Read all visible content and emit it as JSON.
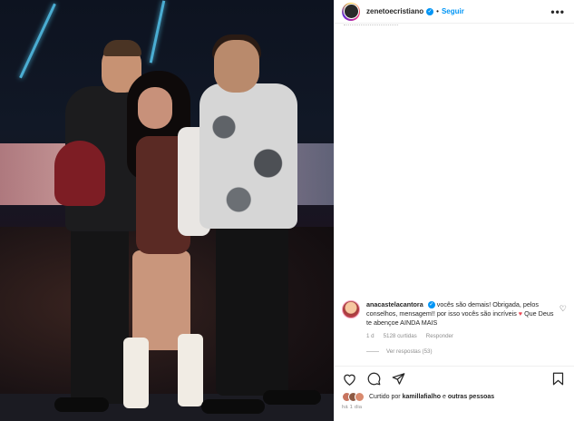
{
  "post": {
    "username": "zenetoecristiano",
    "follow_label": "Seguir",
    "more_label": "•••",
    "separator": "•"
  },
  "comment": {
    "username": "anacastelacantora",
    "text": "vocês são demais! Obrigada, pelos conselhos, mensagem!! por isso vocês são incríveis",
    "heart": "♥",
    "text_end": "Que Deus te abençoe AINDA MAIS",
    "time": "1 d",
    "likes": "5128 curtidas",
    "reply_label": "Responder",
    "view_replies": "Ver respostas (53)"
  },
  "likes": {
    "prefix": "Curtido por",
    "user": "kamillafialho",
    "suffix": "e",
    "others": "outras pessoas"
  },
  "timestamp": "há 1 dia",
  "icons": {
    "like": "heart-icon",
    "comment": "comment-icon",
    "share": "share-icon",
    "save": "bookmark-icon",
    "more": "more-icon",
    "verified": "verified-badge-icon"
  },
  "colors": {
    "link": "#0095f6",
    "meta": "#8e8e8e",
    "text": "#262626",
    "heart": "#ed4956"
  }
}
